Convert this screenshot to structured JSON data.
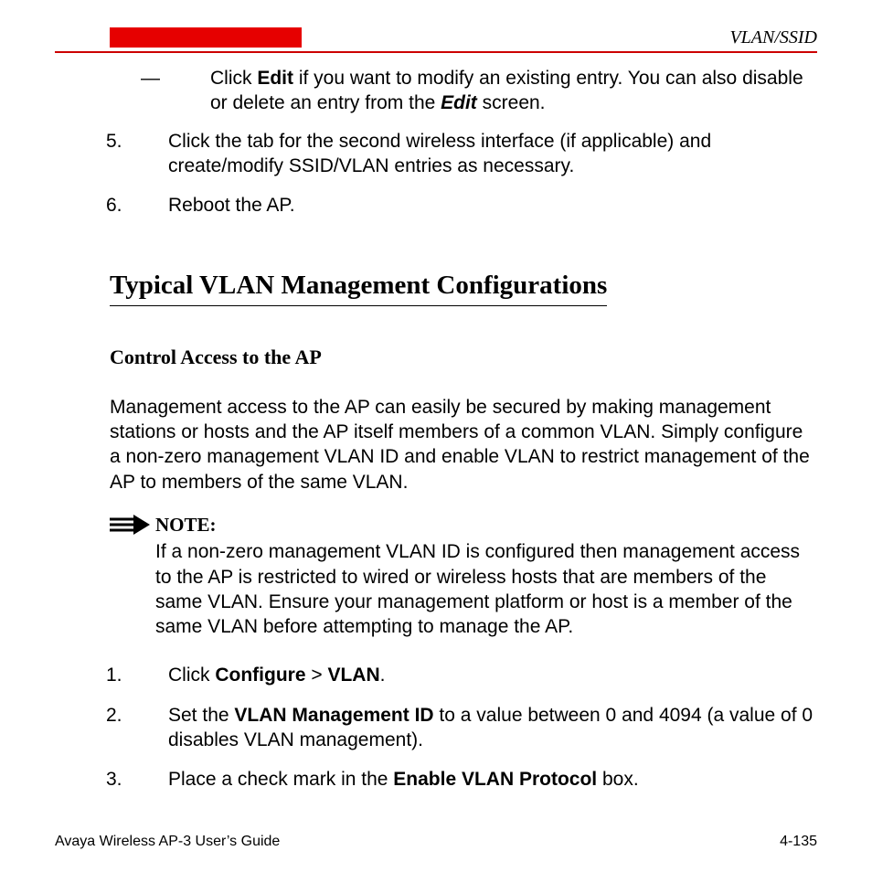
{
  "header": {
    "right_label": "VLAN/SSID"
  },
  "top_list": {
    "dash": {
      "prefix": "—  ",
      "text_a": "Click ",
      "bold_a": "Edit",
      "text_b": " if you want to modify an existing entry. You can also disable or delete an entry from the ",
      "bolditalic_b": "Edit",
      "text_c": " screen."
    },
    "item5": {
      "num": "5.",
      "text": "Click the tab for the second wireless interface (if applicable) and create/modify SSID/VLAN entries as necessary."
    },
    "item6": {
      "num": "6.",
      "text": "Reboot the AP."
    }
  },
  "section_heading": "Typical VLAN Management Configurations",
  "sub_heading": "Control Access to the AP",
  "paragraph1": "Management access to the AP can easily be secured by making management stations or hosts and the AP itself members of a common VLAN. Simply configure a non-zero management VLAN ID and enable VLAN to restrict management of the AP to members of the same VLAN.",
  "note": {
    "label": "NOTE:",
    "text": "If a non-zero management VLAN ID is configured then management access to the AP is restricted to wired or wireless hosts that are members of the same VLAN. Ensure your management platform or host is a member of the same VLAN before attempting to manage the AP."
  },
  "steps": {
    "s1": {
      "num": "1.",
      "a": "Click ",
      "b1": "Configure",
      "gt": " > ",
      "b2": "VLAN",
      "c": "."
    },
    "s2": {
      "num": "2.",
      "a": "Set the ",
      "b1": "VLAN Management ID",
      "b": " to a value between 0 and 4094 (a value of 0 disables VLAN management)."
    },
    "s3": {
      "num": "3.",
      "a": "Place a check mark in the ",
      "b1": "Enable VLAN Protocol",
      "b": " box."
    }
  },
  "footer": {
    "left": "Avaya Wireless AP-3 User’s Guide",
    "right": "4-135"
  }
}
